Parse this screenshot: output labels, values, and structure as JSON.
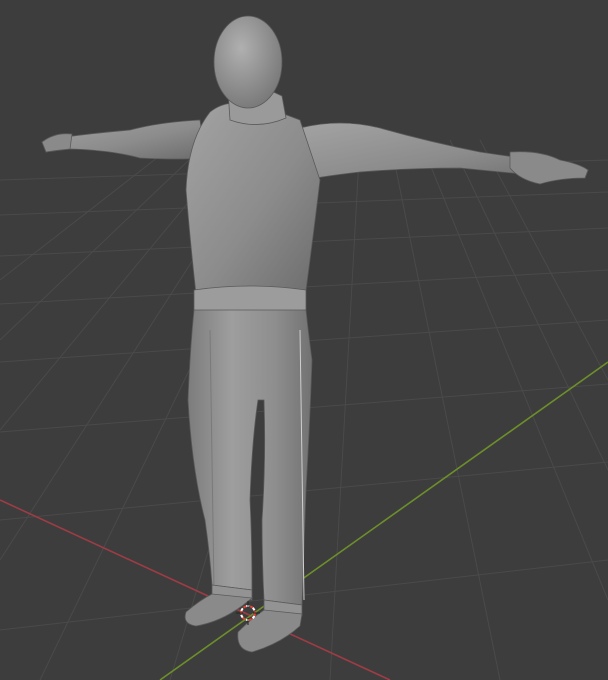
{
  "viewport": {
    "background_color": "#3d3d3d",
    "grid_color": "#4a4a4a",
    "x_axis_color": "#9e3c45",
    "y_axis_color": "#6d8f2a",
    "model_color": "#8e8e8e",
    "cursor_colors": [
      "#e0443a",
      "#ffffff"
    ]
  },
  "scene": {
    "object": "mannequin-model",
    "pose": "T-pose",
    "cursor_icon": "3d-cursor-icon"
  }
}
